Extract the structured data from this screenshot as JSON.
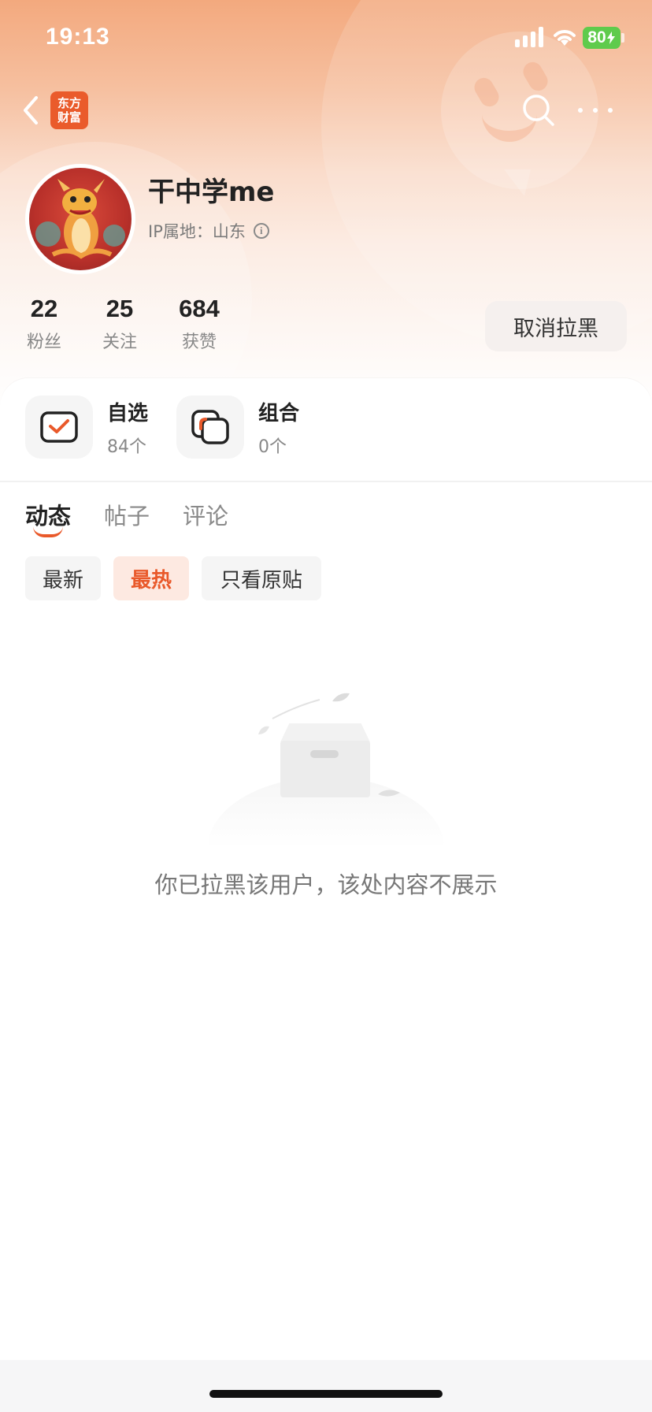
{
  "status_bar": {
    "time": "19:13",
    "battery": "80"
  },
  "nav": {
    "logo_line1": "东方",
    "logo_line2": "财富"
  },
  "profile": {
    "username": "干中学me",
    "ip_label": "IP属地：山东",
    "stats": [
      {
        "value": "22",
        "label": "粉丝"
      },
      {
        "value": "25",
        "label": "关注"
      },
      {
        "value": "684",
        "label": "获赞"
      }
    ],
    "unblock_label": "取消拉黑"
  },
  "features": [
    {
      "title": "自选",
      "count": "84个"
    },
    {
      "title": "组合",
      "count": "0个"
    }
  ],
  "tabs": [
    "动态",
    "帖子",
    "评论"
  ],
  "filters": [
    "最新",
    "最热",
    "只看原贴"
  ],
  "empty_state": {
    "message": "你已拉黑该用户，该处内容不展示"
  },
  "colors": {
    "accent": "#e9592a",
    "battery": "#5fcb4c"
  }
}
